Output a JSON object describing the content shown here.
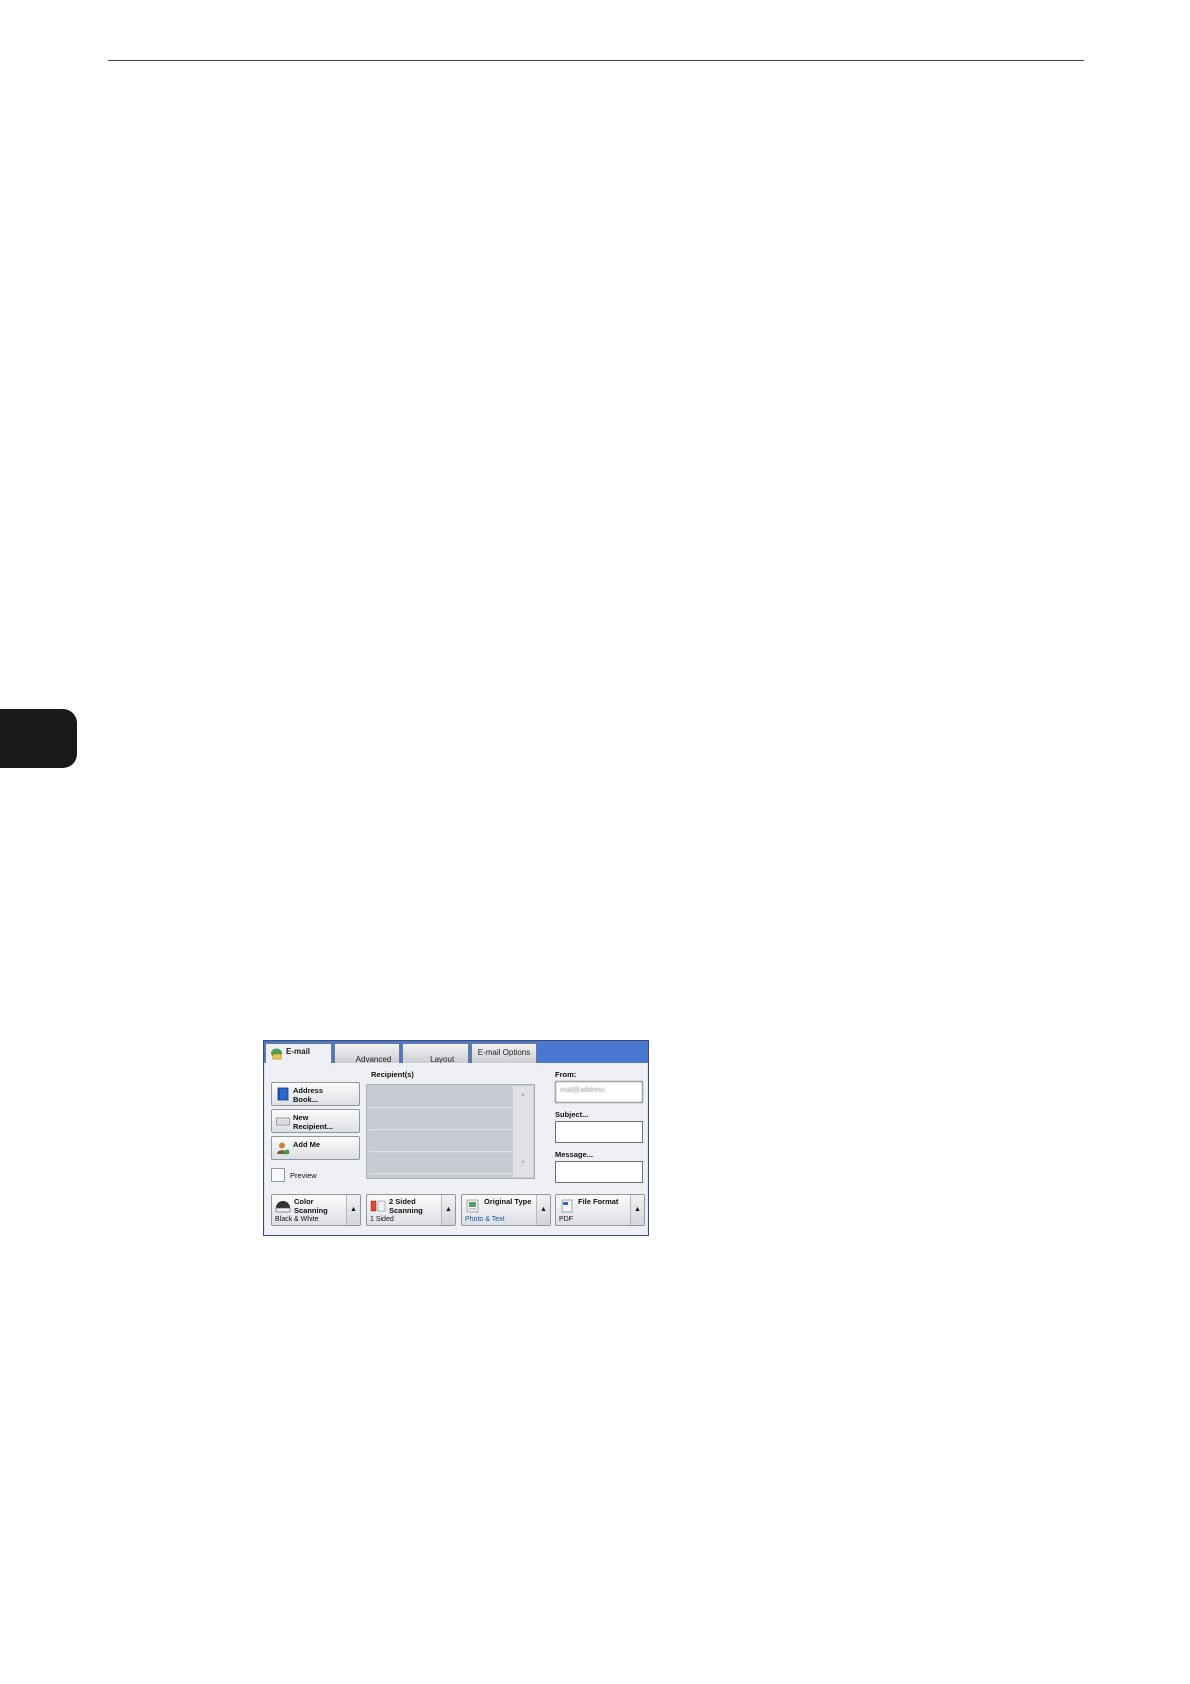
{
  "screen": {
    "tabs": [
      "E-mail",
      "Advanced\nSettings",
      "Layout\nAdjustment",
      "E-mail Options"
    ],
    "left_buttons": [
      "Address\nBook...",
      "New\nRecipient...",
      "Add Me"
    ],
    "preview_label": "Preview",
    "recipients_label": "Recipient(s)",
    "from_label": "From:",
    "from_value": "mail@address",
    "subject_label": "Subject...",
    "message_label": "Message...",
    "features": [
      {
        "title": "Color\nScanning",
        "value": "Black & White",
        "icon": "color-scanning-icon"
      },
      {
        "title": "2 Sided\nScanning",
        "value": "1 Sided",
        "icon": "two-sided-scanning-icon"
      },
      {
        "title": "Original Type",
        "value": "Photo & Text",
        "icon": "original-type-icon"
      },
      {
        "title": "File Format",
        "value": "PDF",
        "icon": "file-format-icon"
      }
    ],
    "colors": {
      "tabbar": "#4a78d0",
      "panel": "#eef0f3",
      "value_blue": "#1a4fb0"
    }
  }
}
